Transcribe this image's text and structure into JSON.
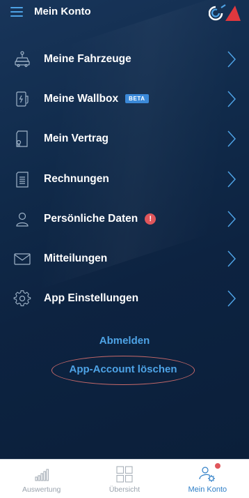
{
  "header": {
    "title": "Mein Konto",
    "menu_icon": "hamburger-menu-icon",
    "logo_icon": "brand-logo-icon"
  },
  "menu": {
    "items": [
      {
        "label": "Meine Fahrzeuge",
        "icon": "car-icon"
      },
      {
        "label": "Meine Wallbox",
        "icon": "wallbox-charger-icon",
        "badge": "BETA"
      },
      {
        "label": "Mein Vertrag",
        "icon": "contract-document-icon"
      },
      {
        "label": "Rechnungen",
        "icon": "invoice-icon"
      },
      {
        "label": "Persönliche Daten",
        "icon": "user-icon",
        "alert": "!"
      },
      {
        "label": "Mitteilungen",
        "icon": "envelope-icon"
      },
      {
        "label": "App Einstellungen",
        "icon": "gear-icon"
      }
    ]
  },
  "actions": {
    "logout": "Abmelden",
    "delete_account": "App-Account löschen"
  },
  "tabbar": {
    "tabs": [
      {
        "label": "Auswertung",
        "icon": "bar-chart-icon"
      },
      {
        "label": "Übersicht",
        "icon": "grid-icon"
      },
      {
        "label": "Mein Konto",
        "icon": "user-settings-icon",
        "active": true
      }
    ]
  },
  "colors": {
    "accent": "#4ea3e6",
    "background": "#102a4a",
    "alert": "#e0565b",
    "tab_active": "#2f7fc7"
  }
}
